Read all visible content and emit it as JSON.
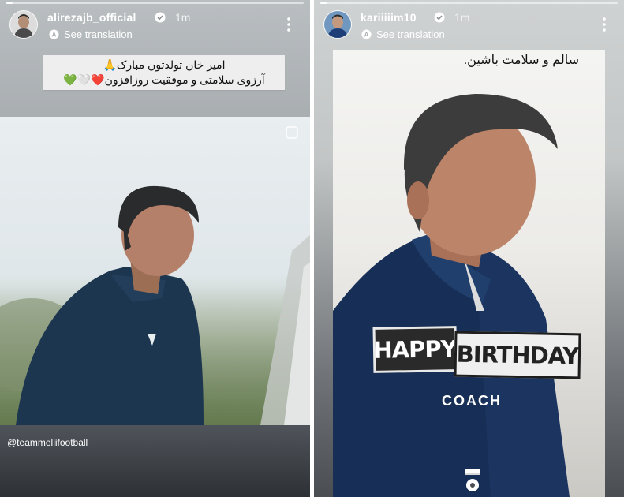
{
  "left_story": {
    "username": "alirezajb_official",
    "time": "1m",
    "see_translation": "See translation",
    "caption_line1": "امیر خان تولدتون مبارک🙏",
    "caption_line2": "آرزوی سلامتی و موفقیت روزافزون❤️🤍💚",
    "mention": "@teammellifootball",
    "progress": 0.02
  },
  "right_story": {
    "username": "kariiiiim10",
    "time": "1m",
    "see_translation": "See translation",
    "caption": "تولدتون مبارک امیر خان همیشه سالم و سلامت باشین.",
    "banner_happy": "HAPPY",
    "banner_birthday": "BIRTHDAY",
    "banner_coach": "COACH",
    "progress": 0.02
  },
  "colors": {
    "green_heart": "#2fb34a",
    "red_heart": "#e0283a",
    "verified_blue": "#ffffff"
  },
  "icons": [
    "verified-badge-icon",
    "translate-icon",
    "more-options-icon",
    "team-crest-icon",
    "save-icon"
  ]
}
